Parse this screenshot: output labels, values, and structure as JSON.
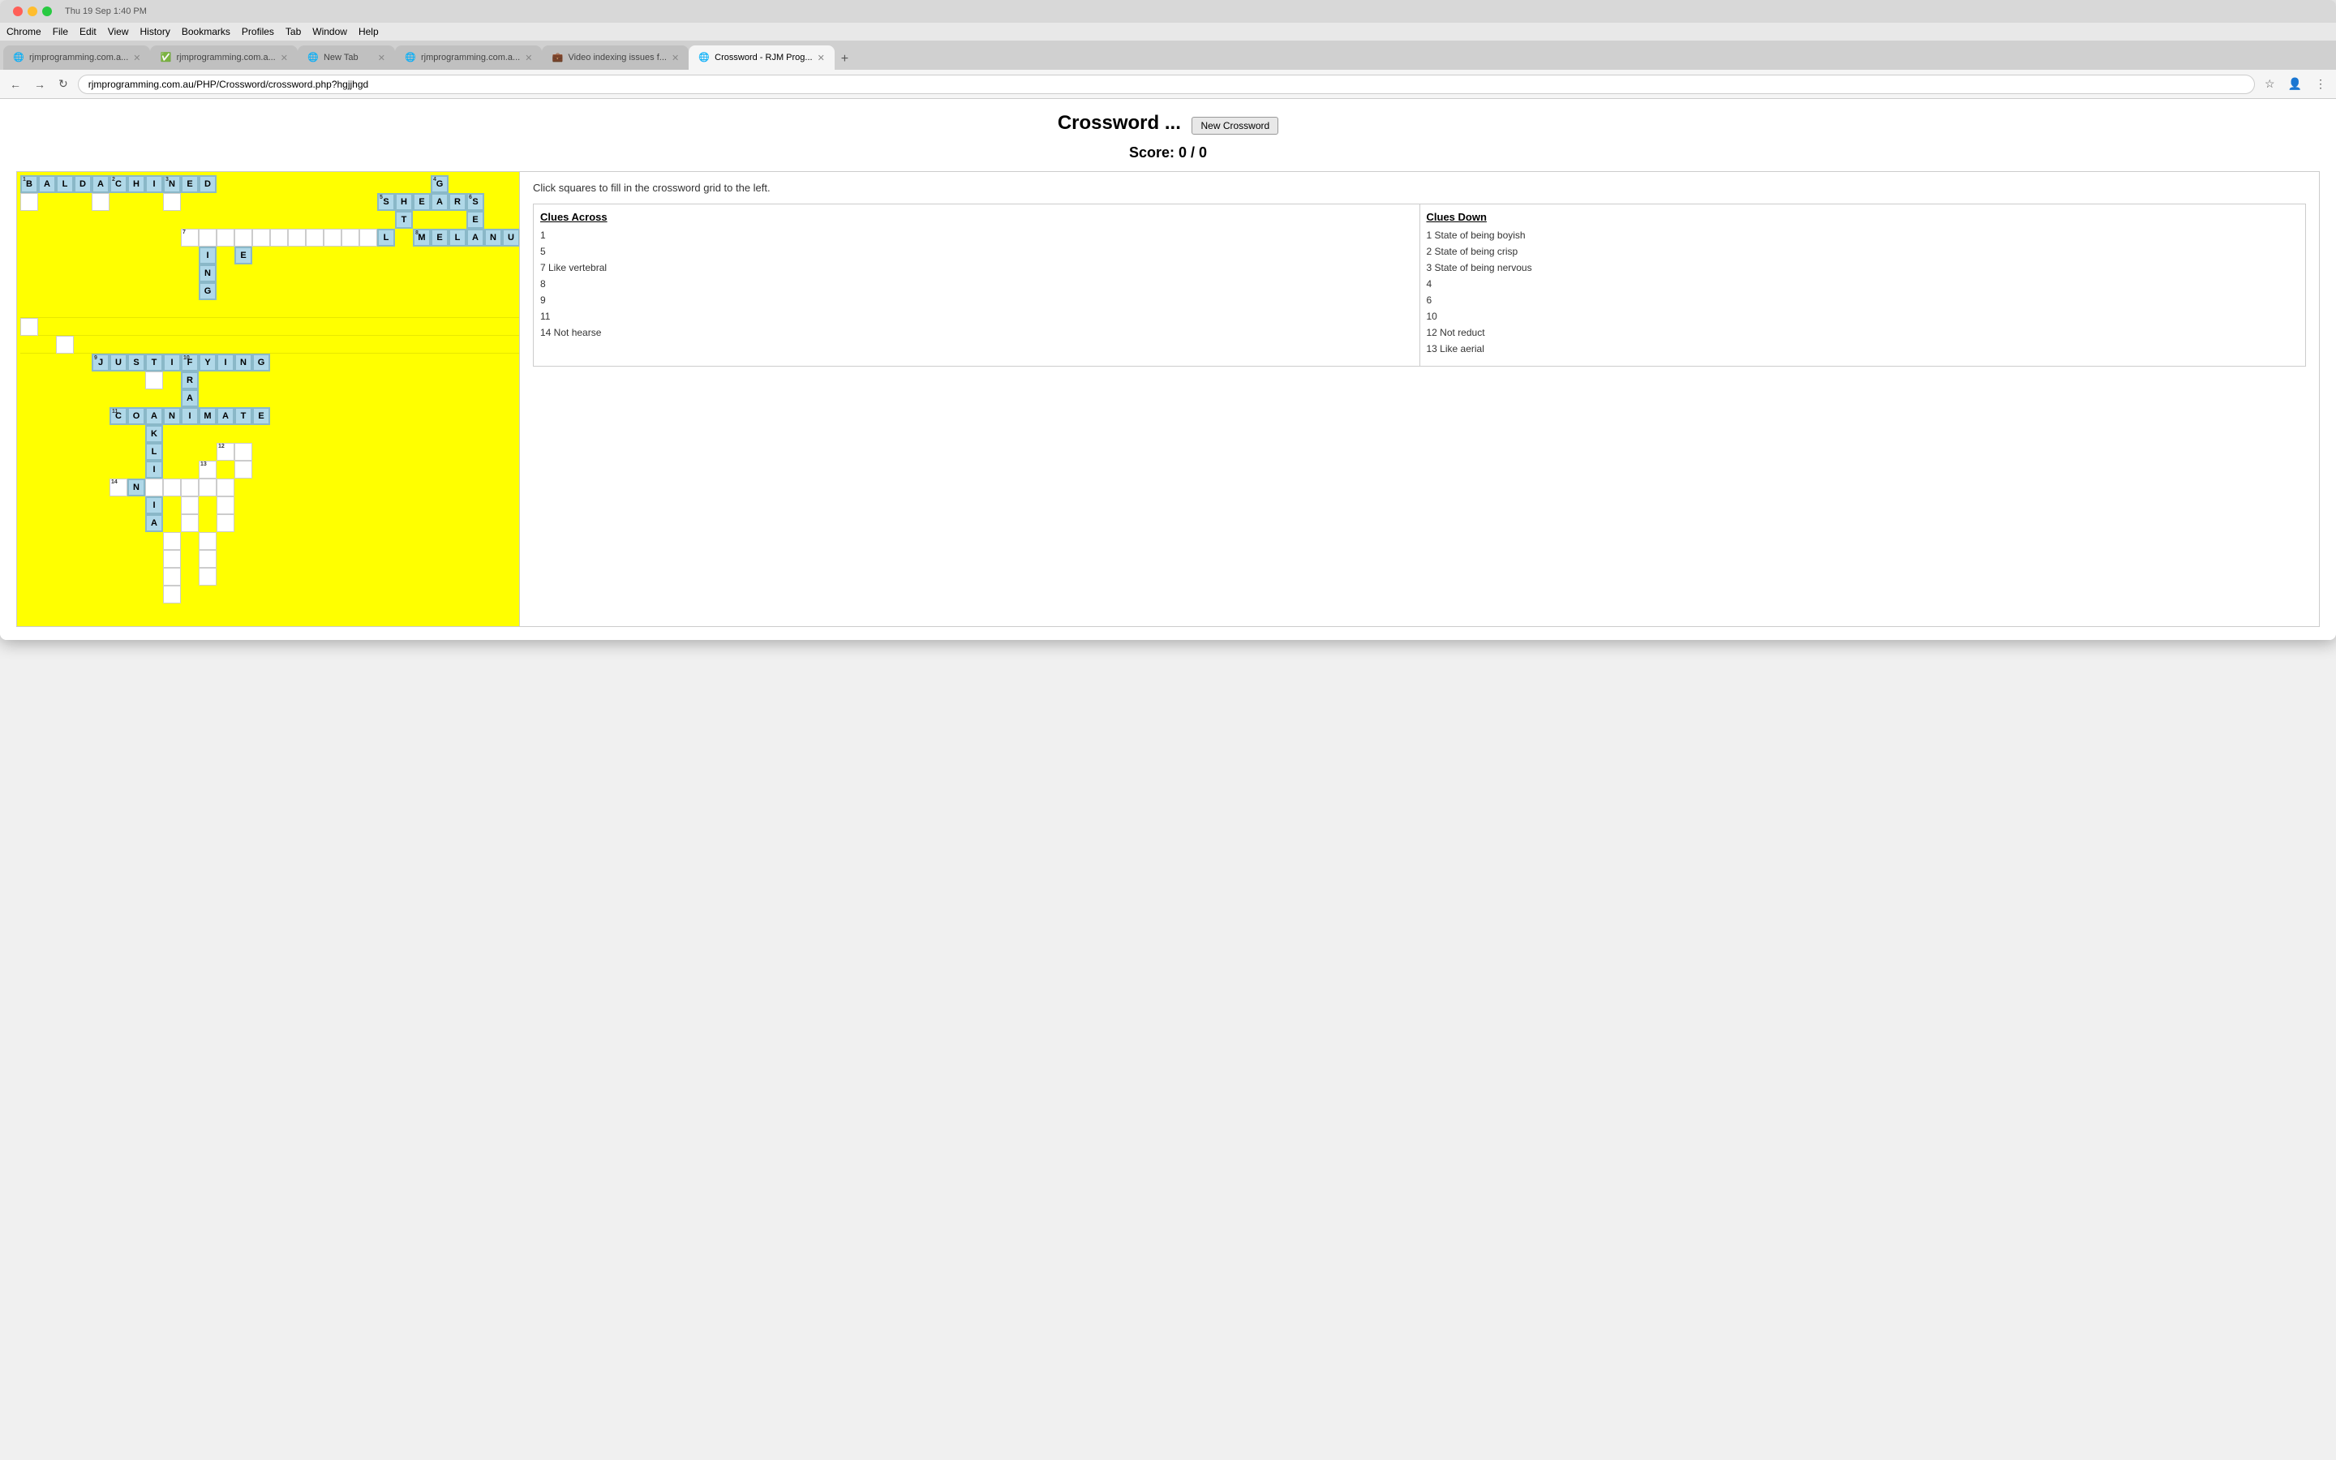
{
  "browser": {
    "title": "Crossword - RJM Prog...",
    "tabs": [
      {
        "id": 1,
        "label": "rjmprogramming.com.a...",
        "active": false,
        "favicon": "🌐"
      },
      {
        "id": 2,
        "label": "rjmprogramming.com.a...",
        "active": false,
        "favicon": "✅"
      },
      {
        "id": 3,
        "label": "New Tab",
        "active": false,
        "favicon": "🌐"
      },
      {
        "id": 4,
        "label": "rjmprogramming.com.a...",
        "active": false,
        "favicon": "🌐"
      },
      {
        "id": 5,
        "label": "Video indexing issues f...",
        "active": false,
        "favicon": "💼"
      },
      {
        "id": 6,
        "label": "Crossword - RJM Prog...",
        "active": true,
        "favicon": "🌐"
      }
    ],
    "address": "rjmprogramming.com.au/PHP/Crossword/crossword.php?hgjjhgd",
    "menu": [
      "Chrome",
      "File",
      "Edit",
      "View",
      "History",
      "Bookmarks",
      "Profiles",
      "Tab",
      "Window",
      "Help"
    ]
  },
  "page": {
    "title": "Crossword ...",
    "new_crossword_button": "New Crossword",
    "score_label": "Score: 0 / 0",
    "instruction": "Click squares to fill in the crossword grid to the left.",
    "clues_across_header": "Clues Across",
    "clues_down_header": "Clues Down",
    "clues_across": [
      {
        "number": "1",
        "clue": ""
      },
      {
        "number": "5",
        "clue": ""
      },
      {
        "number": "7",
        "clue": "Like vertebral"
      },
      {
        "number": "8",
        "clue": ""
      },
      {
        "number": "9",
        "clue": ""
      },
      {
        "number": "11",
        "clue": ""
      },
      {
        "number": "14",
        "clue": "Not hearse"
      }
    ],
    "clues_down": [
      {
        "number": "1",
        "clue": "State of being boyish"
      },
      {
        "number": "2",
        "clue": "State of being crisp"
      },
      {
        "number": "3",
        "clue": "State of being nervous"
      },
      {
        "number": "4",
        "clue": ""
      },
      {
        "number": "6",
        "clue": ""
      },
      {
        "number": "10",
        "clue": ""
      },
      {
        "number": "12",
        "clue": "Not reduct"
      },
      {
        "number": "13",
        "clue": "Like aerial"
      }
    ]
  }
}
